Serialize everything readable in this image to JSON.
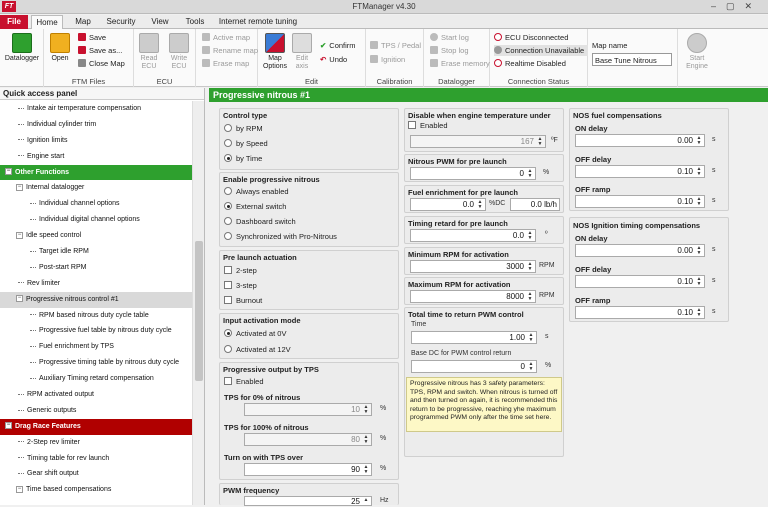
{
  "window": {
    "title": "FTManager v4.30"
  },
  "tabs": [
    {
      "label": "File"
    },
    {
      "label": "Home"
    },
    {
      "label": "Map"
    },
    {
      "label": "Security"
    },
    {
      "label": "View"
    },
    {
      "label": "Tools"
    },
    {
      "label": "Internet remote tuning"
    }
  ],
  "ribbon": {
    "datalogger_btn": "Datalogger",
    "open_btn": "Open",
    "save": "Save",
    "save_as": "Save as...",
    "close_map": "Close Map",
    "ftm_files": "FTM Files",
    "read_ecu": "Read ECU",
    "write_ecu": "Write ECU",
    "ecu_caption": "ECU",
    "active_map": "Active map",
    "rename_map": "Rename map",
    "erase_map": "Erase map",
    "map_options": "Map Options",
    "edit_axis": "Edit axis",
    "confirm": "Confirm",
    "undo": "Undo",
    "edit_caption": "Edit",
    "tps_pedal": "TPS / Pedal",
    "ignition": "Ignition",
    "calibration": "Calibration",
    "start_log": "Start log",
    "stop_log": "Stop log",
    "erase_memory": "Erase memory",
    "datalogger_caption": "Datalogger",
    "ecu_disconnected": "ECU Disconnected",
    "connection_unavailable": "Connection Unavailable",
    "realtime_disabled": "Realtime Disabled",
    "connection_status": "Connection Status",
    "map_name_label": "Map name",
    "map_name_value": "Base Tune Nitrous",
    "start_engine": "Start Engine"
  },
  "sidebar": {
    "title": "Quick access panel",
    "items": [
      {
        "label": "Intake air temperature compensation"
      },
      {
        "label": "Individual cylinder trim"
      },
      {
        "label": "Ignition limits"
      },
      {
        "label": "Engine start"
      },
      {
        "label": "Other Functions"
      },
      {
        "label": "Internal datalogger"
      },
      {
        "label": "Individual channel options"
      },
      {
        "label": "Individual digital channel options"
      },
      {
        "label": "Idle speed control"
      },
      {
        "label": "Target idle RPM"
      },
      {
        "label": "Post-start RPM"
      },
      {
        "label": "Rev limiter"
      },
      {
        "label": "Progressive nitrous control #1"
      },
      {
        "label": "RPM based nitrous duty cycle table"
      },
      {
        "label": "Progressive fuel table by nitrous duty cycle"
      },
      {
        "label": "Fuel enrichment by TPS"
      },
      {
        "label": "Progressive timing table by nitrous duty cycle"
      },
      {
        "label": "Auxiliary Timing retard compensation"
      },
      {
        "label": "RPM activated output"
      },
      {
        "label": "Generic outputs"
      },
      {
        "label": "Drag Race Features"
      },
      {
        "label": "2-Step rev limiter"
      },
      {
        "label": "Timing table for rev launch"
      },
      {
        "label": "Gear shift output"
      },
      {
        "label": "Time based compensations"
      }
    ]
  },
  "page": {
    "title": "Progressive nitrous #1"
  },
  "control_type": {
    "title": "Control type",
    "options": [
      "by RPM",
      "by Speed",
      "by Time"
    ],
    "selected": 2
  },
  "enable_prog": {
    "title": "Enable progressive nitrous",
    "options": [
      "Always enabled",
      "External switch",
      "Dashboard switch",
      "Synchronized with Pro-Nitrous"
    ],
    "selected": 1
  },
  "pre_launch": {
    "title": "Pre launch actuation",
    "options": [
      "2-step",
      "3-step",
      "Burnout"
    ]
  },
  "input_mode": {
    "title": "Input activation mode",
    "options": [
      "Activated at 0V",
      "Activated at 12V"
    ],
    "selected": 0
  },
  "prog_tps": {
    "title": "Progressive output by TPS",
    "enabled": "Enabled",
    "tps0_label": "TPS for 0% of nitrous",
    "tps0_value": "10",
    "tps0_unit": "%",
    "tps100_label": "TPS for 100% of nitrous",
    "tps100_value": "80",
    "tps100_unit": "%",
    "turnon_label": "Turn on with TPS over",
    "turnon_value": "90",
    "turnon_unit": "%"
  },
  "pwm_freq": {
    "title": "PWM frequency",
    "value": "25",
    "unit": "Hz"
  },
  "disable_temp": {
    "title": "Disable when engine temperature under",
    "enabled": "Enabled",
    "value": "167",
    "unit": "ºF"
  },
  "pwm_pre": {
    "title": "Nitrous PWM for pre launch",
    "value": "0",
    "unit": "%"
  },
  "fuel_pre": {
    "title": "Fuel enrichment for pre launch",
    "value1": "0.0",
    "unit1": "%DC",
    "value2": "0.0 lb/h"
  },
  "timing_pre": {
    "title": "Timing retard for pre launch",
    "value": "0.0",
    "unit": "º"
  },
  "min_rpm": {
    "title": "Minimum RPM for activation",
    "value": "3000",
    "unit": "RPM"
  },
  "max_rpm": {
    "title": "Maximum RPM for activation",
    "value": "8000",
    "unit": "RPM"
  },
  "total_time": {
    "title": "Total time to return PWM control",
    "time_label": "Time",
    "time_value": "1.00",
    "time_unit": "s",
    "base_label": "Base DC for PWM control return",
    "base_value": "0",
    "base_unit": "%"
  },
  "note": {
    "text": "Progressive nitrous has 3 safety parameters: TPS, RPM and switch. When nitrous is turned off and then turned on again, it is recommended this return to be progressive, reaching yhe maximum programmed PWM only after the time set here."
  },
  "nos_fuel": {
    "title": "NOS fuel compensations",
    "on_label": "ON delay",
    "on_value": "0.00",
    "off_label": "OFF delay",
    "off_value": "0.10",
    "ramp_label": "OFF ramp",
    "ramp_value": "0.10",
    "unit": "s"
  },
  "nos_ign": {
    "title": "NOS Ignition timing compensations",
    "on_label": "ON delay",
    "on_value": "0.00",
    "off_label": "OFF delay",
    "off_value": "0.10",
    "ramp_label": "OFF ramp",
    "ramp_value": "0.10",
    "unit": "s"
  },
  "colors": {
    "accent_green": "#2ea02e",
    "accent_red": "#b00000",
    "file_tab": "#c8102e"
  }
}
